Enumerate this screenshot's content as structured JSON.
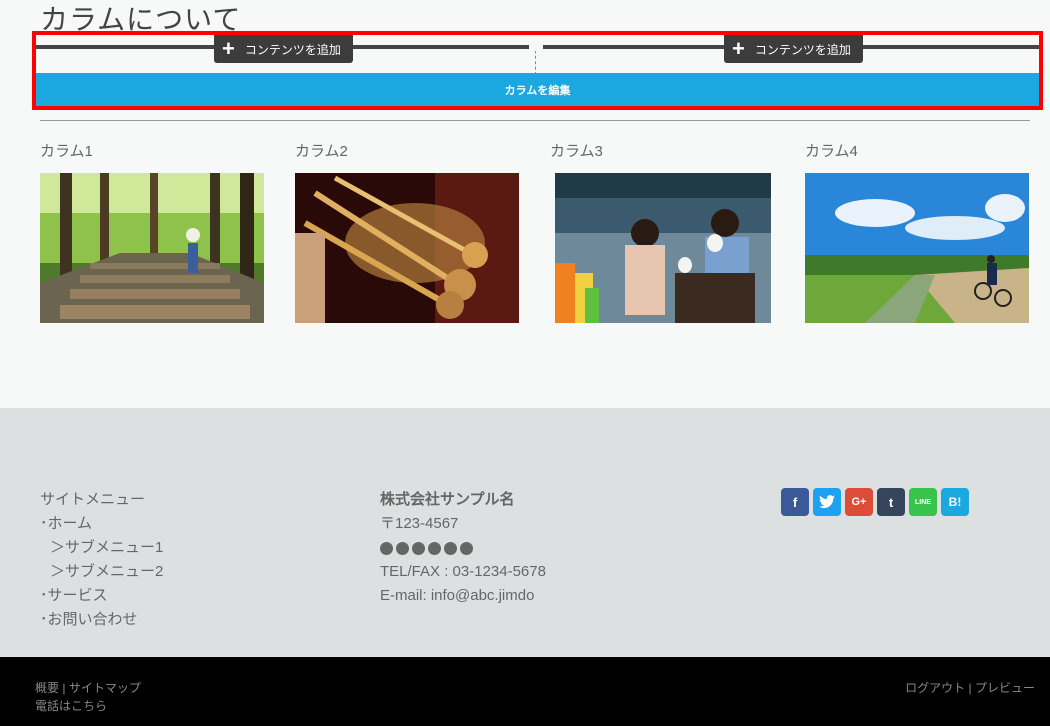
{
  "page": {
    "title": "カラムについて"
  },
  "editor": {
    "add_content_label": "コンテンツを追加",
    "edit_columns_label": "カラムを編集"
  },
  "columns": [
    {
      "label": "カラム1"
    },
    {
      "label": "カラム2"
    },
    {
      "label": "カラム3"
    },
    {
      "label": "カラム4"
    }
  ],
  "footer": {
    "menu": {
      "title": "サイトメニュー",
      "items": [
        {
          "label": "･ホーム"
        },
        {
          "label": "＞サブメニュー1"
        },
        {
          "label": "＞サブメニュー2"
        },
        {
          "label": "･サービス"
        },
        {
          "label": "･お問い合わせ"
        }
      ]
    },
    "company": {
      "name": "株式会社サンプル名",
      "postal": "〒123-4567",
      "tel": "TEL/FAX : 03-1234-5678",
      "email": "E-mail: info@abc.jimdo"
    },
    "social": [
      {
        "icon": "facebook-icon",
        "glyph": "f",
        "color": "#3b5998"
      },
      {
        "icon": "twitter-icon",
        "glyph": "🐦",
        "color": "#1da1f2"
      },
      {
        "icon": "google-plus-icon",
        "glyph": "G+",
        "color": "#dd4b39"
      },
      {
        "icon": "tumblr-icon",
        "glyph": "t",
        "color": "#35465c"
      },
      {
        "icon": "line-icon",
        "glyph": "LINE",
        "color": "#3ac34c"
      },
      {
        "icon": "hatena-bookmark-icon",
        "glyph": "B!",
        "color": "#1ba8e0"
      }
    ]
  },
  "bottom_bar": {
    "about": "概要",
    "sitemap": "サイトマップ",
    "phone": "電話はこちら",
    "logout": "ログアウト",
    "preview": "プレビュー"
  }
}
